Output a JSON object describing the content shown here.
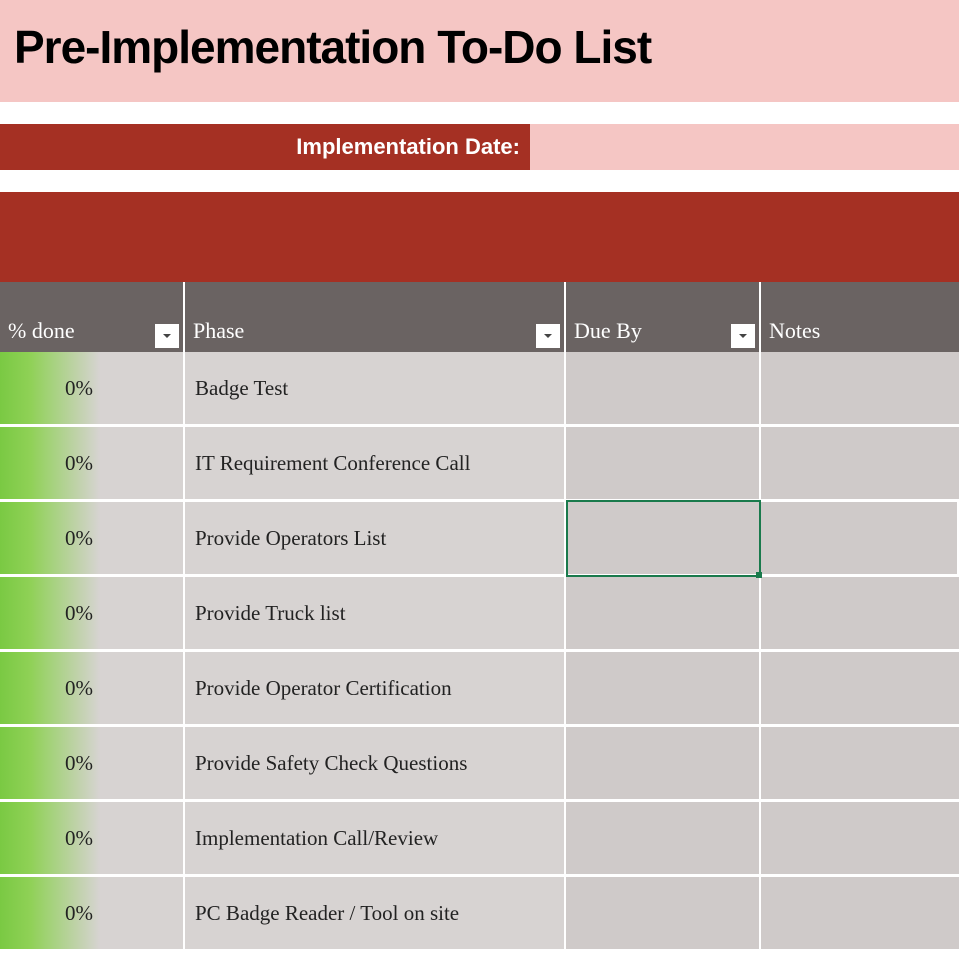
{
  "title": "Pre-Implementation To-Do List",
  "implementation_date_label": "Implementation Date:",
  "implementation_date_value": "",
  "columns": {
    "done": "% done",
    "phase": "Phase",
    "due": "Due By",
    "notes": "Notes"
  },
  "rows": [
    {
      "done": "0%",
      "phase": "Badge Test",
      "due": "",
      "notes": ""
    },
    {
      "done": "0%",
      "phase": "IT Requirement Conference Call",
      "due": "",
      "notes": ""
    },
    {
      "done": "0%",
      "phase": "Provide Operators List",
      "due": "",
      "notes": ""
    },
    {
      "done": "0%",
      "phase": "Provide Truck list",
      "due": "",
      "notes": ""
    },
    {
      "done": "0%",
      "phase": "Provide Operator Certification",
      "due": "",
      "notes": ""
    },
    {
      "done": "0%",
      "phase": "Provide Safety Check Questions",
      "due": "",
      "notes": ""
    },
    {
      "done": "0%",
      "phase": "Implementation Call/Review",
      "due": "",
      "notes": ""
    },
    {
      "done": "0%",
      "phase": "PC Badge Reader / Tool on site",
      "due": "",
      "notes": ""
    }
  ],
  "selected": {
    "row": 2,
    "col": "due"
  }
}
